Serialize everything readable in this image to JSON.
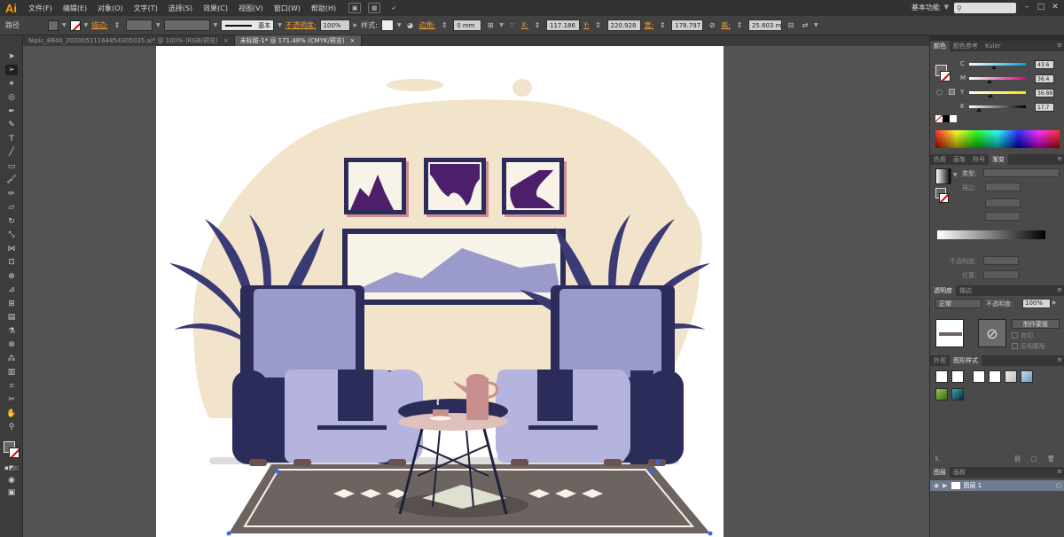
{
  "app": {
    "logo": "Ai"
  },
  "menu": [
    {
      "id": "file",
      "label": "文件(F)"
    },
    {
      "id": "edit",
      "label": "编辑(E)"
    },
    {
      "id": "object",
      "label": "对象(O)"
    },
    {
      "id": "type",
      "label": "文字(T)"
    },
    {
      "id": "select",
      "label": "选择(S)"
    },
    {
      "id": "effect",
      "label": "效果(C)"
    },
    {
      "id": "view",
      "label": "视图(V)"
    },
    {
      "id": "window",
      "label": "窗口(W)"
    },
    {
      "id": "help",
      "label": "帮助(H)"
    }
  ],
  "workspace": {
    "label": "基本功能",
    "search_placeholder": ""
  },
  "control_bar": {
    "selection_label": "路径",
    "stroke_label": "描边:",
    "stroke_style_label": "基本",
    "opacity_label": "不透明度:",
    "opacity_value": "100%",
    "style_label": "样式:",
    "corner_label": "边角:",
    "corner_value": "0 mm",
    "x_label": "X:",
    "x_value": "117.186",
    "y_label": "Y:",
    "y_value": "220.928",
    "w_label": "宽:",
    "w_value": "178.797",
    "h_label": "高:",
    "h_value": "25.603 m"
  },
  "doc_tabs": [
    {
      "label": "Nipic_8840_20200511164854305035.ai* @ 100% (RGB/预览)",
      "close": "×",
      "active": false
    },
    {
      "label": "未标题-1* @ 171.48% (CMYK/预览)",
      "close": "×",
      "active": true
    }
  ],
  "color_panel": {
    "tabs": [
      "颜色",
      "颜色参考",
      "Kuler"
    ],
    "channels": [
      {
        "name": "C",
        "value": "43.6",
        "pos": 0.436,
        "gradient": [
          "#ffffff",
          "#00a0e0"
        ]
      },
      {
        "name": "M",
        "value": "36.4",
        "pos": 0.364,
        "gradient": [
          "#ffffff",
          "#e0007a"
        ]
      },
      {
        "name": "Y",
        "value": "36.88",
        "pos": 0.369,
        "gradient": [
          "#ffffff",
          "#ffe000"
        ]
      },
      {
        "name": "K",
        "value": "17.7",
        "pos": 0.177,
        "gradient": [
          "#ffffff",
          "#000000"
        ]
      }
    ]
  },
  "gradient_panel": {
    "tabs": [
      "色板",
      "画笔",
      "符号",
      "渐变"
    ],
    "type_label": "类型:",
    "stroke_label": "描边:",
    "opacity_label": "不透明度:",
    "position_label": "位置:"
  },
  "transparency_panel": {
    "tabs": [
      "透明度",
      "描边"
    ],
    "blend_mode": "正常",
    "opacity_label": "不透明度:",
    "opacity_value": "100%",
    "make_mask_label": "制作蒙版",
    "clip_label": "剪切",
    "invert_mask_label": "反相蒙版"
  },
  "graphic_styles_panel": {
    "tabs": [
      "外观",
      "图形样式"
    ]
  },
  "layers_panel": {
    "tabs": [
      "图层",
      "画板"
    ],
    "layer_name": "图层 1"
  },
  "colors": {
    "panel_bg": "#4a4a4a",
    "canvas_bg": "#535353",
    "menubar_bg": "#323232",
    "accent_orange": "#ff9a00"
  },
  "illustration": {
    "beige": "#f2e3cb",
    "lavender": "#9b9bcb",
    "navy": "#2c2c5a",
    "frame_art": "#4d1f6b",
    "mauve": "#c98f8f",
    "rug": "#6d6461",
    "cream": "#f8f3e8"
  }
}
